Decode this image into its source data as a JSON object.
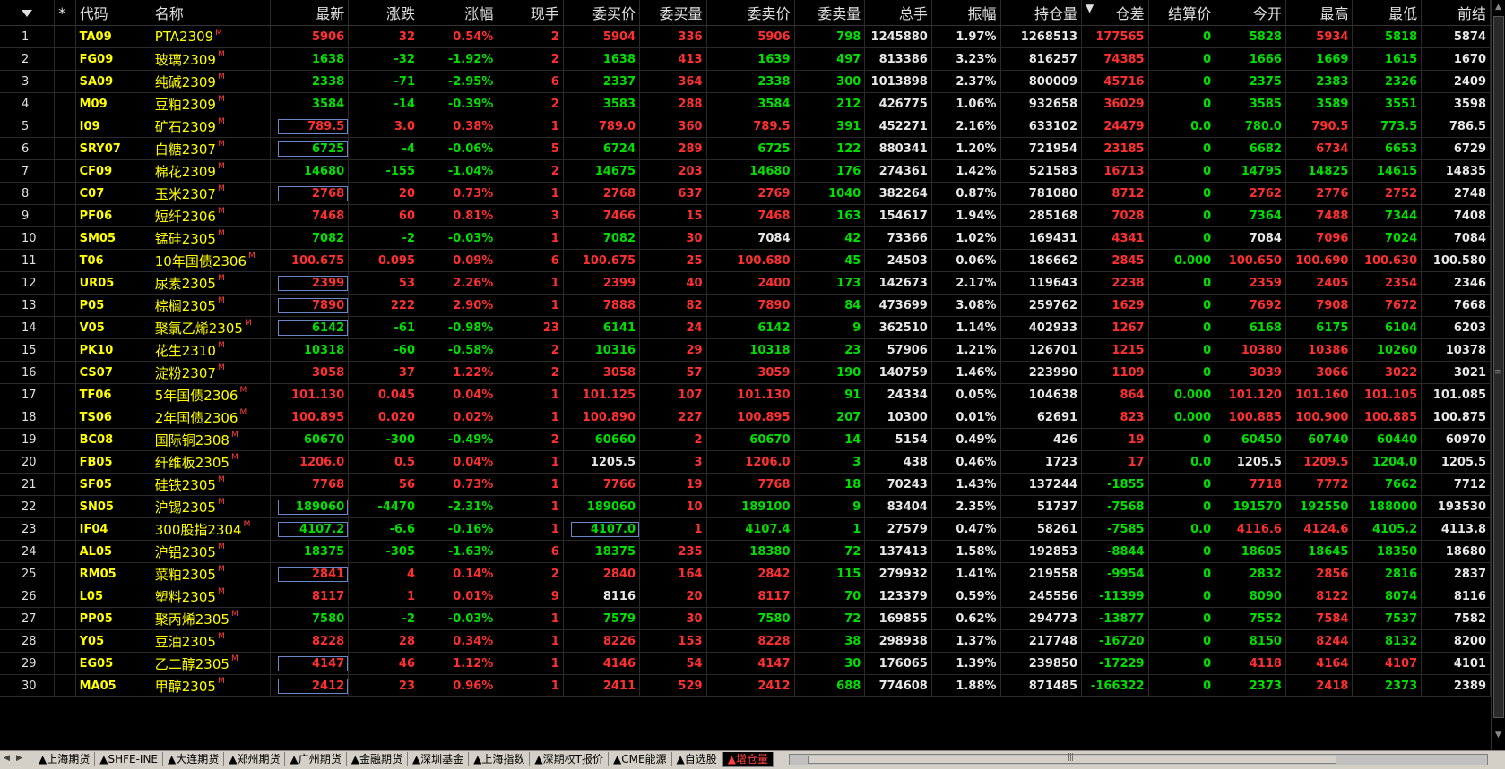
{
  "columns": {
    "sel": "",
    "star": "*",
    "code": "代码",
    "name": "名称",
    "last": "最新",
    "chg": "涨跌",
    "pct": "涨幅",
    "vol_now": "现手",
    "bid": "委买价",
    "bid_qty": "委买量",
    "ask": "委卖价",
    "ask_qty": "委卖量",
    "total": "总手",
    "amp": "振幅",
    "oi": "持仓量",
    "oi_diff_arrow": "▼",
    "oi_diff": "仓差",
    "settle": "结算价",
    "open": "今开",
    "high": "最高",
    "low": "最低",
    "prev": "前结"
  },
  "name_marker": "M",
  "colors": {
    "up": "#ff3030",
    "down": "#00e000",
    "flat": "#e8e8e8",
    "code": "#ffff00",
    "box": "#6a88c8"
  },
  "rows": [
    {
      "n": "1",
      "code": "TA09",
      "name": "PTA2309",
      "last": "5906",
      "chg": "32",
      "pct": "0.54%",
      "vol": "2",
      "bid": "5904",
      "bq": "336",
      "ask": "5906",
      "aq": "798",
      "total": "1245880",
      "amp": "1.97%",
      "oi": "1268513",
      "diff": "177565",
      "settle": "0",
      "open": "5828",
      "high": "5934",
      "low": "5818",
      "prev": "5874",
      "dir": "up",
      "box": false,
      "bidbox": false,
      "oc": "dn",
      "hc": "up",
      "lc": "dn"
    },
    {
      "n": "2",
      "code": "FG09",
      "name": "玻璃2309",
      "last": "1638",
      "chg": "-32",
      "pct": "-1.92%",
      "vol": "2",
      "bid": "1638",
      "bq": "413",
      "ask": "1639",
      "aq": "497",
      "total": "813386",
      "amp": "3.23%",
      "oi": "816257",
      "diff": "74385",
      "settle": "0",
      "open": "1666",
      "high": "1669",
      "low": "1615",
      "prev": "1670",
      "dir": "dn",
      "box": false,
      "bidbox": false,
      "oc": "dn",
      "hc": "dn",
      "lc": "dn"
    },
    {
      "n": "3",
      "code": "SA09",
      "name": "纯碱2309",
      "last": "2338",
      "chg": "-71",
      "pct": "-2.95%",
      "vol": "6",
      "bid": "2337",
      "bq": "364",
      "ask": "2338",
      "aq": "300",
      "total": "1013898",
      "amp": "2.37%",
      "oi": "800009",
      "diff": "45716",
      "settle": "0",
      "open": "2375",
      "high": "2383",
      "low": "2326",
      "prev": "2409",
      "dir": "dn",
      "box": false,
      "bidbox": false,
      "oc": "dn",
      "hc": "dn",
      "lc": "dn"
    },
    {
      "n": "4",
      "code": "M09",
      "name": "豆粕2309",
      "last": "3584",
      "chg": "-14",
      "pct": "-0.39%",
      "vol": "2",
      "bid": "3583",
      "bq": "288",
      "ask": "3584",
      "aq": "212",
      "total": "426775",
      "amp": "1.06%",
      "oi": "932658",
      "diff": "36029",
      "settle": "0",
      "open": "3585",
      "high": "3589",
      "low": "3551",
      "prev": "3598",
      "dir": "dn",
      "box": false,
      "bidbox": false,
      "oc": "dn",
      "hc": "dn",
      "lc": "dn"
    },
    {
      "n": "5",
      "code": "I09",
      "name": "矿石2309",
      "last": "789.5",
      "chg": "3.0",
      "pct": "0.38%",
      "vol": "1",
      "bid": "789.0",
      "bq": "360",
      "ask": "789.5",
      "aq": "391",
      "total": "452271",
      "amp": "2.16%",
      "oi": "633102",
      "diff": "24479",
      "settle": "0.0",
      "open": "780.0",
      "high": "790.5",
      "low": "773.5",
      "prev": "786.5",
      "dir": "up",
      "box": true,
      "bidbox": false,
      "oc": "dn",
      "hc": "up",
      "lc": "dn"
    },
    {
      "n": "6",
      "code": "SRY07",
      "name": "白糖2307",
      "last": "6725",
      "chg": "-4",
      "pct": "-0.06%",
      "vol": "5",
      "bid": "6724",
      "bq": "289",
      "ask": "6725",
      "aq": "122",
      "total": "880341",
      "amp": "1.20%",
      "oi": "721954",
      "diff": "23185",
      "settle": "0",
      "open": "6682",
      "high": "6734",
      "low": "6653",
      "prev": "6729",
      "dir": "dn",
      "box": true,
      "bidbox": false,
      "oc": "dn",
      "hc": "up",
      "lc": "dn"
    },
    {
      "n": "7",
      "code": "CF09",
      "name": "棉花2309",
      "last": "14680",
      "chg": "-155",
      "pct": "-1.04%",
      "vol": "2",
      "bid": "14675",
      "bq": "203",
      "ask": "14680",
      "aq": "176",
      "total": "274361",
      "amp": "1.42%",
      "oi": "521583",
      "diff": "16713",
      "settle": "0",
      "open": "14795",
      "high": "14825",
      "low": "14615",
      "prev": "14835",
      "dir": "dn",
      "box": false,
      "bidbox": false,
      "oc": "dn",
      "hc": "dn",
      "lc": "dn"
    },
    {
      "n": "8",
      "code": "C07",
      "name": "玉米2307",
      "last": "2768",
      "chg": "20",
      "pct": "0.73%",
      "vol": "1",
      "bid": "2768",
      "bq": "637",
      "ask": "2769",
      "aq": "1040",
      "total": "382264",
      "amp": "0.87%",
      "oi": "781080",
      "diff": "8712",
      "settle": "0",
      "open": "2762",
      "high": "2776",
      "low": "2752",
      "prev": "2748",
      "dir": "up",
      "box": true,
      "bidbox": false,
      "oc": "up",
      "hc": "up",
      "lc": "up"
    },
    {
      "n": "9",
      "code": "PF06",
      "name": "短纤2306",
      "last": "7468",
      "chg": "60",
      "pct": "0.81%",
      "vol": "3",
      "bid": "7466",
      "bq": "15",
      "ask": "7468",
      "aq": "163",
      "total": "154617",
      "amp": "1.94%",
      "oi": "285168",
      "diff": "7028",
      "settle": "0",
      "open": "7364",
      "high": "7488",
      "low": "7344",
      "prev": "7408",
      "dir": "up",
      "box": false,
      "bidbox": false,
      "oc": "dn",
      "hc": "up",
      "lc": "dn"
    },
    {
      "n": "10",
      "code": "SM05",
      "name": "锰硅2305",
      "last": "7082",
      "chg": "-2",
      "pct": "-0.03%",
      "vol": "1",
      "bid": "7082",
      "bq": "30",
      "ask": "7084",
      "aq": "42",
      "total": "73366",
      "amp": "1.02%",
      "oi": "169431",
      "diff": "4341",
      "settle": "0",
      "open": "7084",
      "high": "7096",
      "low": "7024",
      "prev": "7084",
      "dir": "dn",
      "box": false,
      "bidbox": false,
      "oc": "wt",
      "hc": "up",
      "lc": "dn",
      "askc": "wt"
    },
    {
      "n": "11",
      "code": "T06",
      "name": "10年国债2306",
      "last": "100.675",
      "chg": "0.095",
      "pct": "0.09%",
      "vol": "6",
      "bid": "100.675",
      "bq": "25",
      "ask": "100.680",
      "aq": "45",
      "total": "24503",
      "amp": "0.06%",
      "oi": "186662",
      "diff": "2845",
      "settle": "0.000",
      "open": "100.650",
      "high": "100.690",
      "low": "100.630",
      "prev": "100.580",
      "dir": "up",
      "box": false,
      "bidbox": false,
      "oc": "up",
      "hc": "up",
      "lc": "up"
    },
    {
      "n": "12",
      "code": "UR05",
      "name": "尿素2305",
      "last": "2399",
      "chg": "53",
      "pct": "2.26%",
      "vol": "1",
      "bid": "2399",
      "bq": "40",
      "ask": "2400",
      "aq": "173",
      "total": "142673",
      "amp": "2.17%",
      "oi": "119643",
      "diff": "2238",
      "settle": "0",
      "open": "2359",
      "high": "2405",
      "low": "2354",
      "prev": "2346",
      "dir": "up",
      "box": true,
      "bidbox": false,
      "oc": "up",
      "hc": "up",
      "lc": "up"
    },
    {
      "n": "13",
      "code": "P05",
      "name": "棕榈2305",
      "last": "7890",
      "chg": "222",
      "pct": "2.90%",
      "vol": "1",
      "bid": "7888",
      "bq": "82",
      "ask": "7890",
      "aq": "84",
      "total": "473699",
      "amp": "3.08%",
      "oi": "259762",
      "diff": "1629",
      "settle": "0",
      "open": "7692",
      "high": "7908",
      "low": "7672",
      "prev": "7668",
      "dir": "up",
      "box": true,
      "bidbox": false,
      "oc": "up",
      "hc": "up",
      "lc": "up"
    },
    {
      "n": "14",
      "code": "V05",
      "name": "聚氯乙烯2305",
      "last": "6142",
      "chg": "-61",
      "pct": "-0.98%",
      "vol": "23",
      "bid": "6141",
      "bq": "24",
      "ask": "6142",
      "aq": "9",
      "total": "362510",
      "amp": "1.14%",
      "oi": "402933",
      "diff": "1267",
      "settle": "0",
      "open": "6168",
      "high": "6175",
      "low": "6104",
      "prev": "6203",
      "dir": "dn",
      "box": true,
      "bidbox": false,
      "oc": "dn",
      "hc": "dn",
      "lc": "dn"
    },
    {
      "n": "15",
      "code": "PK10",
      "name": "花生2310",
      "last": "10318",
      "chg": "-60",
      "pct": "-0.58%",
      "vol": "2",
      "bid": "10316",
      "bq": "29",
      "ask": "10318",
      "aq": "23",
      "total": "57906",
      "amp": "1.21%",
      "oi": "126701",
      "diff": "1215",
      "settle": "0",
      "open": "10380",
      "high": "10386",
      "low": "10260",
      "prev": "10378",
      "dir": "dn",
      "box": false,
      "bidbox": false,
      "oc": "up",
      "hc": "up",
      "lc": "dn"
    },
    {
      "n": "16",
      "code": "CS07",
      "name": "淀粉2307",
      "last": "3058",
      "chg": "37",
      "pct": "1.22%",
      "vol": "2",
      "bid": "3058",
      "bq": "57",
      "ask": "3059",
      "aq": "190",
      "total": "140759",
      "amp": "1.46%",
      "oi": "223990",
      "diff": "1109",
      "settle": "0",
      "open": "3039",
      "high": "3066",
      "low": "3022",
      "prev": "3021",
      "dir": "up",
      "box": false,
      "bidbox": false,
      "oc": "up",
      "hc": "up",
      "lc": "up"
    },
    {
      "n": "17",
      "code": "TF06",
      "name": "5年国债2306",
      "last": "101.130",
      "chg": "0.045",
      "pct": "0.04%",
      "vol": "1",
      "bid": "101.125",
      "bq": "107",
      "ask": "101.130",
      "aq": "91",
      "total": "24334",
      "amp": "0.05%",
      "oi": "104638",
      "diff": "864",
      "settle": "0.000",
      "open": "101.120",
      "high": "101.160",
      "low": "101.105",
      "prev": "101.085",
      "dir": "up",
      "box": false,
      "bidbox": false,
      "oc": "up",
      "hc": "up",
      "lc": "up"
    },
    {
      "n": "18",
      "code": "TS06",
      "name": "2年国债2306",
      "last": "100.895",
      "chg": "0.020",
      "pct": "0.02%",
      "vol": "1",
      "bid": "100.890",
      "bq": "227",
      "ask": "100.895",
      "aq": "207",
      "total": "10300",
      "amp": "0.01%",
      "oi": "62691",
      "diff": "823",
      "settle": "0.000",
      "open": "100.885",
      "high": "100.900",
      "low": "100.885",
      "prev": "100.875",
      "dir": "up",
      "box": false,
      "bidbox": false,
      "oc": "up",
      "hc": "up",
      "lc": "up"
    },
    {
      "n": "19",
      "code": "BC08",
      "name": "国际铜2308",
      "last": "60670",
      "chg": "-300",
      "pct": "-0.49%",
      "vol": "2",
      "bid": "60660",
      "bq": "2",
      "ask": "60670",
      "aq": "14",
      "total": "5154",
      "amp": "0.49%",
      "oi": "426",
      "diff": "19",
      "settle": "0",
      "open": "60450",
      "high": "60740",
      "low": "60440",
      "prev": "60970",
      "dir": "dn",
      "box": false,
      "bidbox": false,
      "oc": "dn",
      "hc": "dn",
      "lc": "dn"
    },
    {
      "n": "20",
      "code": "FB05",
      "name": "纤维板2305",
      "last": "1206.0",
      "chg": "0.5",
      "pct": "0.04%",
      "vol": "1",
      "bid": "1205.5",
      "bq": "3",
      "ask": "1206.0",
      "aq": "3",
      "total": "438",
      "amp": "0.46%",
      "oi": "1723",
      "diff": "17",
      "settle": "0.0",
      "open": "1205.5",
      "high": "1209.5",
      "low": "1204.0",
      "prev": "1205.5",
      "dir": "up",
      "box": false,
      "bidbox": false,
      "oc": "wt",
      "hc": "up",
      "lc": "dn",
      "bidc": "wt"
    },
    {
      "n": "21",
      "code": "SF05",
      "name": "硅铁2305",
      "last": "7768",
      "chg": "56",
      "pct": "0.73%",
      "vol": "1",
      "bid": "7766",
      "bq": "19",
      "ask": "7768",
      "aq": "18",
      "total": "70243",
      "amp": "1.43%",
      "oi": "137244",
      "diff": "-1855",
      "settle": "0",
      "open": "7718",
      "high": "7772",
      "low": "7662",
      "prev": "7712",
      "dir": "up",
      "box": false,
      "bidbox": false,
      "oc": "up",
      "hc": "up",
      "lc": "dn"
    },
    {
      "n": "22",
      "code": "SN05",
      "name": "沪锡2305",
      "last": "189060",
      "chg": "-4470",
      "pct": "-2.31%",
      "vol": "1",
      "bid": "189060",
      "bq": "10",
      "ask": "189100",
      "aq": "9",
      "total": "83404",
      "amp": "2.35%",
      "oi": "51737",
      "diff": "-7568",
      "settle": "0",
      "open": "191570",
      "high": "192550",
      "low": "188000",
      "prev": "193530",
      "dir": "dn",
      "box": true,
      "bidbox": false,
      "oc": "dn",
      "hc": "dn",
      "lc": "dn"
    },
    {
      "n": "23",
      "code": "IF04",
      "name": "300股指2304",
      "last": "4107.2",
      "chg": "-6.6",
      "pct": "-0.16%",
      "vol": "1",
      "bid": "4107.0",
      "bq": "1",
      "ask": "4107.4",
      "aq": "1",
      "total": "27579",
      "amp": "0.47%",
      "oi": "58261",
      "diff": "-7585",
      "settle": "0.0",
      "open": "4116.6",
      "high": "4124.6",
      "low": "4105.2",
      "prev": "4113.8",
      "dir": "dn",
      "box": true,
      "bidbox": true,
      "oc": "up",
      "hc": "up",
      "lc": "dn"
    },
    {
      "n": "24",
      "code": "AL05",
      "name": "沪铝2305",
      "last": "18375",
      "chg": "-305",
      "pct": "-1.63%",
      "vol": "6",
      "bid": "18375",
      "bq": "235",
      "ask": "18380",
      "aq": "72",
      "total": "137413",
      "amp": "1.58%",
      "oi": "192853",
      "diff": "-8844",
      "settle": "0",
      "open": "18605",
      "high": "18645",
      "low": "18350",
      "prev": "18680",
      "dir": "dn",
      "box": false,
      "bidbox": false,
      "oc": "dn",
      "hc": "dn",
      "lc": "dn"
    },
    {
      "n": "25",
      "code": "RM05",
      "name": "菜粕2305",
      "last": "2841",
      "chg": "4",
      "pct": "0.14%",
      "vol": "2",
      "bid": "2840",
      "bq": "164",
      "ask": "2842",
      "aq": "115",
      "total": "279932",
      "amp": "1.41%",
      "oi": "219558",
      "diff": "-9954",
      "settle": "0",
      "open": "2832",
      "high": "2856",
      "low": "2816",
      "prev": "2837",
      "dir": "up",
      "box": true,
      "bidbox": false,
      "oc": "dn",
      "hc": "up",
      "lc": "dn"
    },
    {
      "n": "26",
      "code": "L05",
      "name": "塑料2305",
      "last": "8117",
      "chg": "1",
      "pct": "0.01%",
      "vol": "9",
      "bid": "8116",
      "bq": "20",
      "ask": "8117",
      "aq": "70",
      "total": "123379",
      "amp": "0.59%",
      "oi": "245556",
      "diff": "-11399",
      "settle": "0",
      "open": "8090",
      "high": "8122",
      "low": "8074",
      "prev": "8116",
      "dir": "up",
      "box": false,
      "bidbox": false,
      "oc": "dn",
      "hc": "up",
      "lc": "dn",
      "bidc": "wt"
    },
    {
      "n": "27",
      "code": "PP05",
      "name": "聚丙烯2305",
      "last": "7580",
      "chg": "-2",
      "pct": "-0.03%",
      "vol": "1",
      "bid": "7579",
      "bq": "30",
      "ask": "7580",
      "aq": "72",
      "total": "169855",
      "amp": "0.62%",
      "oi": "294773",
      "diff": "-13877",
      "settle": "0",
      "open": "7552",
      "high": "7584",
      "low": "7537",
      "prev": "7582",
      "dir": "dn",
      "box": false,
      "bidbox": false,
      "oc": "dn",
      "hc": "up",
      "lc": "dn"
    },
    {
      "n": "28",
      "code": "Y05",
      "name": "豆油2305",
      "last": "8228",
      "chg": "28",
      "pct": "0.34%",
      "vol": "1",
      "bid": "8226",
      "bq": "153",
      "ask": "8228",
      "aq": "38",
      "total": "298938",
      "amp": "1.37%",
      "oi": "217748",
      "diff": "-16720",
      "settle": "0",
      "open": "8150",
      "high": "8244",
      "low": "8132",
      "prev": "8200",
      "dir": "up",
      "box": false,
      "bidbox": false,
      "oc": "dn",
      "hc": "up",
      "lc": "dn"
    },
    {
      "n": "29",
      "code": "EG05",
      "name": "乙二醇2305",
      "last": "4147",
      "chg": "46",
      "pct": "1.12%",
      "vol": "1",
      "bid": "4146",
      "bq": "54",
      "ask": "4147",
      "aq": "30",
      "total": "176065",
      "amp": "1.39%",
      "oi": "239850",
      "diff": "-17229",
      "settle": "0",
      "open": "4118",
      "high": "4164",
      "low": "4107",
      "prev": "4101",
      "dir": "up",
      "box": true,
      "bidbox": false,
      "oc": "up",
      "hc": "up",
      "lc": "up"
    },
    {
      "n": "30",
      "code": "MA05",
      "name": "甲醇2305",
      "last": "2412",
      "chg": "23",
      "pct": "0.96%",
      "vol": "1",
      "bid": "2411",
      "bq": "529",
      "ask": "2412",
      "aq": "688",
      "total": "774608",
      "amp": "1.88%",
      "oi": "871485",
      "diff": "-166322",
      "settle": "0",
      "open": "2373",
      "high": "2418",
      "low": "2373",
      "prev": "2389",
      "dir": "up",
      "box": true,
      "bidbox": false,
      "oc": "dn",
      "hc": "up",
      "lc": "dn"
    }
  ],
  "tabs": [
    {
      "label": "▲上海期货",
      "active": false
    },
    {
      "label": "▲SHFE-INE",
      "active": false
    },
    {
      "label": "▲大连期货",
      "active": false
    },
    {
      "label": "▲郑州期货",
      "active": false
    },
    {
      "label": "▲广州期货",
      "active": false
    },
    {
      "label": "▲金融期货",
      "active": false
    },
    {
      "label": "▲深圳基金",
      "active": false
    },
    {
      "label": "▲上海指数",
      "active": false
    },
    {
      "label": "▲深期权T报价",
      "active": false
    },
    {
      "label": "▲CME能源",
      "active": false
    },
    {
      "label": "▲自选股",
      "active": false
    },
    {
      "label": "▲增仓量",
      "active": true
    }
  ],
  "icons": {
    "sort": "sort-desc-icon",
    "tab_prev": "tab-prev-icon",
    "tab_next": "tab-next-icon",
    "scroll_up": "scroll-up-icon",
    "scroll_down": "scroll-down-icon"
  }
}
